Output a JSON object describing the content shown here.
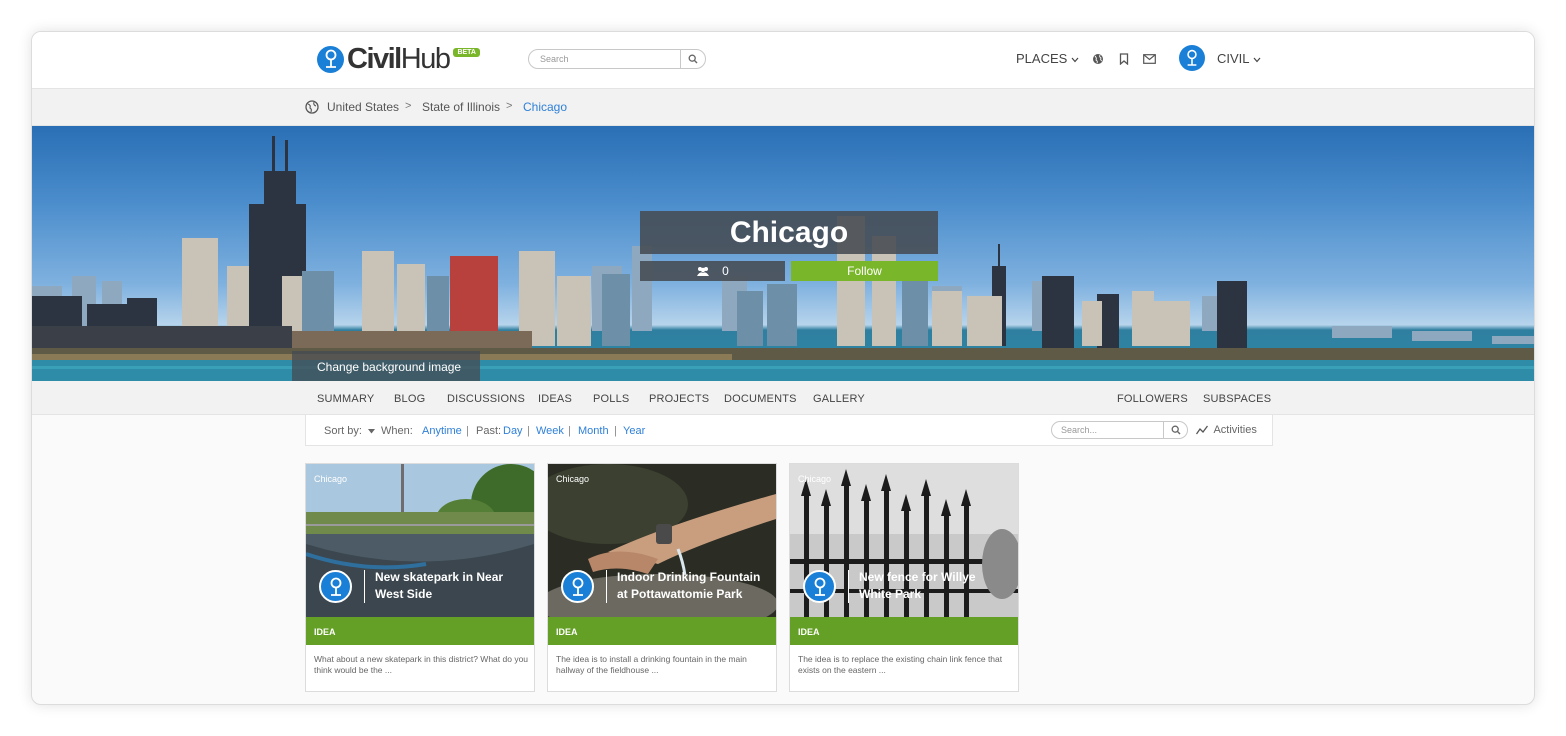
{
  "header": {
    "logo_bold": "Civil",
    "logo_thin": "Hub",
    "beta": "BETA",
    "search_placeholder": "Search",
    "places": "PLACES",
    "user_name": "CIVIL"
  },
  "breadcrumb": [
    "United States",
    ">",
    "State of Illinois",
    ">",
    "Chicago"
  ],
  "hero": {
    "title": "Chicago",
    "followers_count": "0",
    "follow_label": "Follow",
    "change_bg_label": "Change background image"
  },
  "tabs": [
    "SUMMARY",
    "BLOG",
    "DISCUSSIONS",
    "IDEAS",
    "POLLS",
    "PROJECTS",
    "DOCUMENTS",
    "GALLERY"
  ],
  "tabs_right": [
    "FOLLOWERS",
    "SUBSPACES"
  ],
  "filter": {
    "sort_by": "Sort by:",
    "when": "When:",
    "anytime": "Anytime",
    "past": "Past:",
    "day": "Day",
    "week": "Week",
    "month": "Month",
    "year": "Year",
    "sep": "|",
    "search_placeholder": "Search...",
    "activities": "Activities"
  },
  "cards": [
    {
      "place": "Chicago",
      "title": "New skatepark in Near West Side",
      "type": "IDEA",
      "desc": "What about a new skatepark in this district? What do you think would be the ..."
    },
    {
      "place": "Chicago",
      "title": "Indoor Drinking Fountain at Pottawattomie Park",
      "type": "IDEA",
      "desc": "The idea is to install a drinking fountain in the main hallway of the fieldhouse ..."
    },
    {
      "place": "Chicago",
      "title": "New fence for Willye White Park",
      "type": "IDEA",
      "desc": "The idea is to replace the existing chain link fence that exists on the eastern ..."
    }
  ],
  "colors": {
    "brand_blue": "#1a7fd6",
    "follow_green": "#7ab629",
    "idea_green": "#63a025",
    "link_blue": "#2f80d8"
  },
  "icons": [
    "search-icon",
    "globe-icon",
    "bookmark-icon",
    "mail-icon",
    "chevron-down-icon",
    "followers-icon",
    "activities-icon",
    "caret-down-icon"
  ]
}
